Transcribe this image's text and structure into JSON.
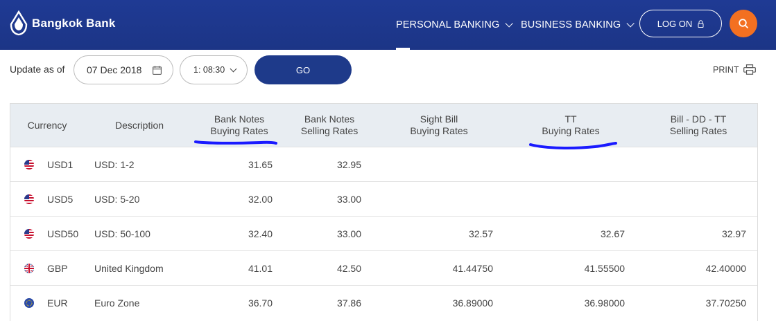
{
  "header": {
    "brand": "Bangkok Bank",
    "nav": [
      {
        "label": "PERSONAL BANKING"
      },
      {
        "label": "BUSINESS BANKING"
      }
    ],
    "logon_label": "LOG ON"
  },
  "toolbar": {
    "update_label": "Update as of",
    "date": "07 Dec 2018",
    "time": "1: 08:30",
    "go_label": "GO",
    "print_label": "PRINT"
  },
  "table": {
    "headers": [
      {
        "line1": "Currency",
        "line2": ""
      },
      {
        "line1": "Description",
        "line2": ""
      },
      {
        "line1": "Bank Notes",
        "line2": "Buying Rates"
      },
      {
        "line1": "Bank Notes",
        "line2": "Selling Rates"
      },
      {
        "line1": "Sight Bill",
        "line2": "Buying Rates"
      },
      {
        "line1": "TT",
        "line2": "Buying Rates"
      },
      {
        "line1": "Bill - DD - TT",
        "line2": "Selling Rates"
      }
    ],
    "rows": [
      {
        "flag": "us",
        "currency": "USD1",
        "description": "USD: 1-2",
        "bn_buy": "31.65",
        "bn_sell": "32.95",
        "sight_buy": "",
        "tt_buy": "",
        "bill_sell": ""
      },
      {
        "flag": "us",
        "currency": "USD5",
        "description": "USD: 5-20",
        "bn_buy": "32.00",
        "bn_sell": "33.00",
        "sight_buy": "",
        "tt_buy": "",
        "bill_sell": ""
      },
      {
        "flag": "us",
        "currency": "USD50",
        "description": "USD: 50-100",
        "bn_buy": "32.40",
        "bn_sell": "33.00",
        "sight_buy": "32.57",
        "tt_buy": "32.67",
        "bill_sell": "32.97"
      },
      {
        "flag": "gb",
        "currency": "GBP",
        "description": "United Kingdom",
        "bn_buy": "41.01",
        "bn_sell": "42.50",
        "sight_buy": "41.44750",
        "tt_buy": "41.55500",
        "bill_sell": "42.40000"
      },
      {
        "flag": "eu",
        "currency": "EUR",
        "description": "Euro Zone",
        "bn_buy": "36.70",
        "bn_sell": "37.86",
        "sight_buy": "36.89000",
        "tt_buy": "36.98000",
        "bill_sell": "37.70250"
      }
    ]
  },
  "colors": {
    "header_blue": "#1e3a8a",
    "search_orange": "#f37021",
    "annotation_blue": "#1a1aff"
  }
}
